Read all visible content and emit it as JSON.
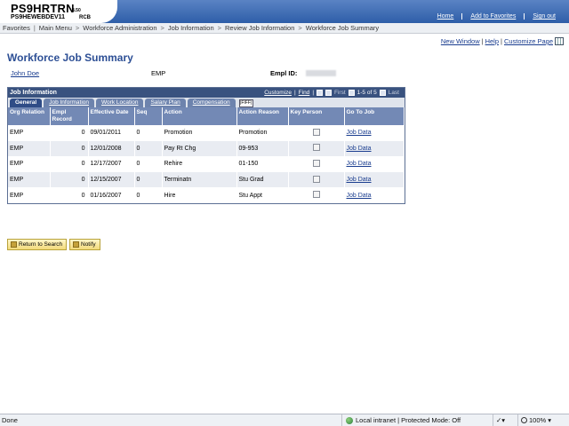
{
  "logo": {
    "main": "PS9HRTRN",
    "version": "8.50",
    "sub": "PS9HEWEBDEV11",
    "tag": "RCB"
  },
  "toplinks": [
    "Home",
    "Add to Favorites",
    "Sign out"
  ],
  "breadcrumb": [
    "Favorites",
    "Main Menu",
    "Workforce Administration",
    "Job Information",
    "Review Job Information",
    "Workforce Job Summary"
  ],
  "pagelinks": {
    "new_window": "New Window",
    "help": "Help",
    "customize": "Customize Page"
  },
  "page": {
    "title": "Workforce Job Summary",
    "employee_name": "John Doe",
    "emp_type": "EMP",
    "emplid_label": "Empl ID:"
  },
  "grid": {
    "title": "Job Information",
    "customize": "Customize",
    "find": "Find",
    "first": "First",
    "range": "1-5 of 5",
    "last": "Last",
    "tabs": [
      "General",
      "Job Information",
      "Work Location",
      "Salary Plan",
      "Compensation"
    ],
    "tab_icon": "|FIFF|",
    "columns": [
      "Org Relation",
      "Empl Record",
      "Effective Date",
      "Seq",
      "Action",
      "Action Reason",
      "Key Person",
      "Go To Job"
    ],
    "rows": [
      {
        "org": "EMP",
        "rec": "0",
        "date": "09/01/2011",
        "seq": "0",
        "action": "Promotion",
        "reason": "Promotion",
        "link": "Job Data"
      },
      {
        "org": "EMP",
        "rec": "0",
        "date": "12/01/2008",
        "seq": "0",
        "action": "Pay Rt Chg",
        "reason": "09-953",
        "link": "Job Data"
      },
      {
        "org": "EMP",
        "rec": "0",
        "date": "12/17/2007",
        "seq": "0",
        "action": "Rehire",
        "reason": "01-150",
        "link": "Job Data"
      },
      {
        "org": "EMP",
        "rec": "0",
        "date": "12/15/2007",
        "seq": "0",
        "action": "Terminatn",
        "reason": "Stu Grad",
        "link": "Job Data"
      },
      {
        "org": "EMP",
        "rec": "0",
        "date": "01/16/2007",
        "seq": "0",
        "action": "Hire",
        "reason": "Stu Appt",
        "link": "Job Data"
      }
    ]
  },
  "buttons": {
    "return": "Return to Search",
    "notify": "Notify"
  },
  "status": {
    "left": "Done",
    "zone": "Local intranet | Protected Mode: Off",
    "zoom": "100%"
  }
}
